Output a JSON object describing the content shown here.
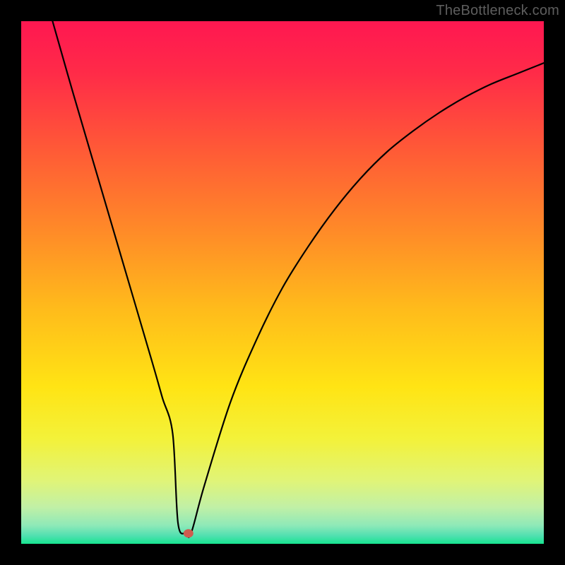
{
  "watermark": "TheBottleneck.com",
  "chart_data": {
    "type": "line",
    "title": "",
    "xlabel": "",
    "ylabel": "",
    "xlim": [
      0,
      100
    ],
    "ylim": [
      0,
      100
    ],
    "grid": false,
    "series": [
      {
        "name": "curve",
        "x": [
          6,
          10,
          15,
          20,
          25,
          27,
          29,
          30,
          31.5,
          32.5,
          35,
          40,
          45,
          50,
          55,
          60,
          65,
          70,
          75,
          80,
          85,
          90,
          95,
          100
        ],
        "y": [
          100,
          86,
          69,
          52,
          35,
          28,
          21,
          4,
          2,
          2,
          11,
          27,
          39,
          49,
          57,
          64,
          70,
          75,
          79,
          82.5,
          85.5,
          88,
          90,
          92
        ]
      }
    ],
    "marker": {
      "x": 32,
      "y": 2,
      "color": "#cf5b4f"
    },
    "background_gradient": {
      "type": "vertical",
      "stops": [
        {
          "offset": 0.0,
          "color": "#ff1751"
        },
        {
          "offset": 0.1,
          "color": "#ff2b48"
        },
        {
          "offset": 0.25,
          "color": "#ff5b36"
        },
        {
          "offset": 0.4,
          "color": "#ff8a28"
        },
        {
          "offset": 0.55,
          "color": "#ffbb1b"
        },
        {
          "offset": 0.7,
          "color": "#ffe414"
        },
        {
          "offset": 0.8,
          "color": "#f3f23a"
        },
        {
          "offset": 0.88,
          "color": "#e0f478"
        },
        {
          "offset": 0.93,
          "color": "#c1f0a6"
        },
        {
          "offset": 0.965,
          "color": "#8ee9b8"
        },
        {
          "offset": 0.985,
          "color": "#4fe0b0"
        },
        {
          "offset": 1.0,
          "color": "#17e48f"
        }
      ]
    }
  }
}
